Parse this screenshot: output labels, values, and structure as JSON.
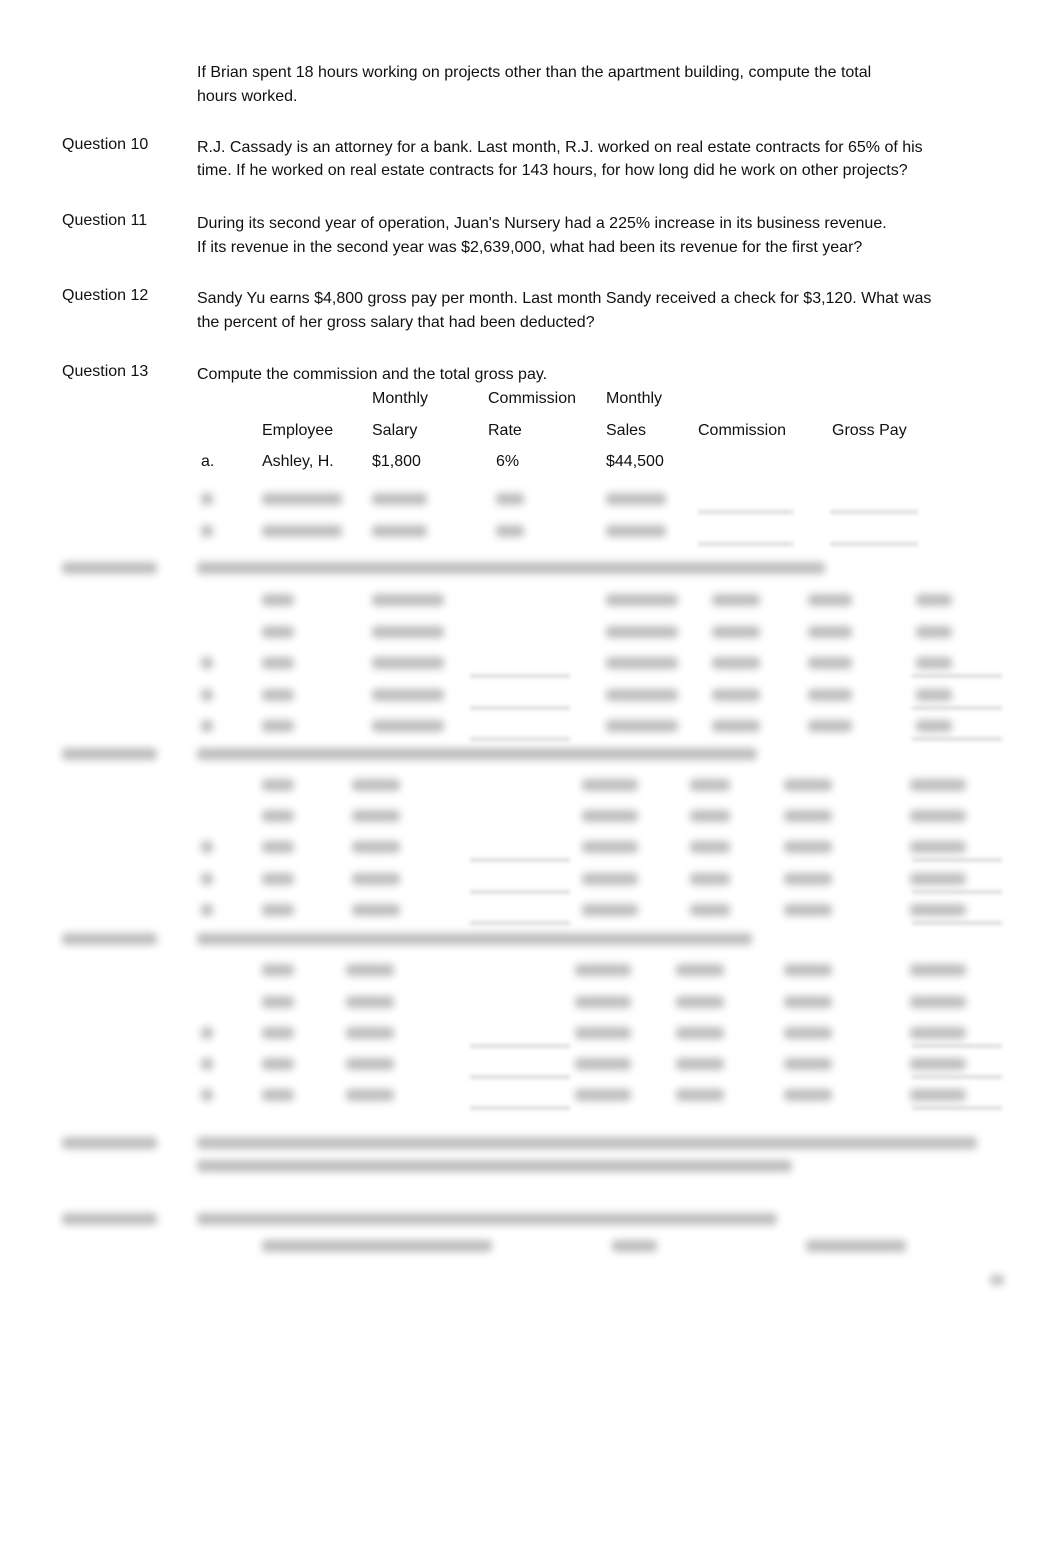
{
  "intro": {
    "line1": "If Brian spent 18 hours working on projects other than the apartment building, compute the total",
    "line2": "hours worked."
  },
  "questions": [
    {
      "label": "Question 10",
      "lines": [
        "R.J. Cassady is an attorney for a bank. Last month, R.J. worked on real estate contracts for 65% of his",
        "time. If he worked on real estate contracts for 143 hours, for how long did he work on other projects?"
      ]
    },
    {
      "label": "Question 11",
      "lines": [
        "During its second year of operation, Juan's Nursery had a 225% increase in its business revenue.",
        "If its revenue in the second year was $2,639,000, what had been its revenue for the first year?"
      ]
    },
    {
      "label": "Question 12",
      "lines": [
        "Sandy Yu earns $4,800 gross pay per month. Last month Sandy received a check for $3,120. What was",
        "the percent of her gross salary that had been deducted?"
      ]
    },
    {
      "label": "Question 13",
      "lines": [
        "Compute the commission and the total gross pay."
      ]
    }
  ],
  "table13": {
    "header_top": {
      "salary": "Monthly",
      "rate": "Commission",
      "sales": "Monthly"
    },
    "header": {
      "employee": "Employee",
      "salary": "Salary",
      "rate": "Rate",
      "sales": "Sales",
      "commission": "Commission",
      "gross": "Gross Pay"
    },
    "rows": [
      {
        "letter": "a.",
        "employee": "Ashley, H.",
        "salary": "$1,800",
        "rate": "6%",
        "sales": "$44,500"
      }
    ]
  }
}
